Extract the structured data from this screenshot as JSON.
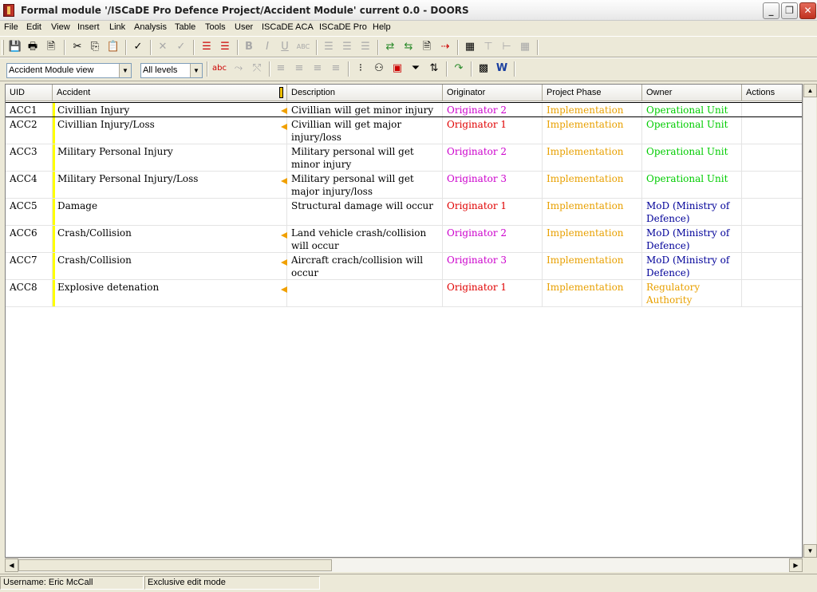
{
  "window": {
    "title": "Formal module '/ISCaDE Pro Defence Project/Accident Module' current 0.0 - DOORS"
  },
  "menu": [
    "File",
    "Edit",
    "View",
    "Insert",
    "Link",
    "Analysis",
    "Table",
    "Tools",
    "User",
    "ISCaDE ACA",
    "ISCaDE Pro",
    "Help"
  ],
  "toolbar": {
    "view_select": "Accident Module view",
    "level_select": "All levels"
  },
  "table": {
    "columns": [
      "UID",
      "Accident",
      "Description",
      "Originator",
      "Project Phase",
      "Owner",
      "Actions"
    ],
    "rows": [
      {
        "uid": "ACC1",
        "accident": "Civillian Injury",
        "description": "Civillian will get minor injury",
        "originator": "Originator 2",
        "phase": "Implementation",
        "owner": "Operational Unit",
        "flag": true,
        "selected": true
      },
      {
        "uid": "ACC2",
        "accident": "Civillian Injury/Loss",
        "description": "Civillian will get major injury/loss",
        "originator": "Originator 1",
        "phase": "Implementation",
        "owner": "Operational Unit",
        "flag": true
      },
      {
        "uid": "ACC3",
        "accident": "Military Personal Injury",
        "description": "Military personal will get minor injury",
        "originator": "Originator 2",
        "phase": "Implementation",
        "owner": "Operational Unit",
        "flag": false
      },
      {
        "uid": "ACC4",
        "accident": "Military Personal Injury/Loss",
        "description": "Military personal will get major injury/loss",
        "originator": "Originator 3",
        "phase": "Implementation",
        "owner": "Operational Unit",
        "flag": true
      },
      {
        "uid": "ACC5",
        "accident": "Damage",
        "description": "Structural damage will occur",
        "originator": "Originator 1",
        "phase": "Implementation",
        "owner": "MoD (Ministry of Defence)",
        "flag": false
      },
      {
        "uid": "ACC6",
        "accident": "Crash/Collision",
        "description": "Land vehicle crash/collision will occur",
        "originator": "Originator 2",
        "phase": "Implementation",
        "owner": "MoD (Ministry of Defence)",
        "flag": true
      },
      {
        "uid": "ACC7",
        "accident": "Crash/Collision",
        "description": "Aircraft crach/collision will occur",
        "originator": "Originator 3",
        "phase": "Implementation",
        "owner": "MoD (Ministry of Defence)",
        "flag": true
      },
      {
        "uid": "ACC8",
        "accident": "Explosive detenation",
        "description": "",
        "originator": "Originator 1",
        "phase": "Implementation",
        "owner": "Regulatory Authority",
        "flag": true
      }
    ]
  },
  "status": {
    "username": "Username: Eric McCall",
    "mode": "Exclusive edit mode"
  },
  "colors": {
    "originator_1": "#e00000",
    "originator_2": "#cc00cc",
    "originator_3": "#cc00cc",
    "phase": "#e8a000",
    "owner_operational": "#00cc00",
    "owner_mod": "#000099",
    "owner_regulatory": "#e8a000",
    "change_bar": "#ffff00"
  }
}
